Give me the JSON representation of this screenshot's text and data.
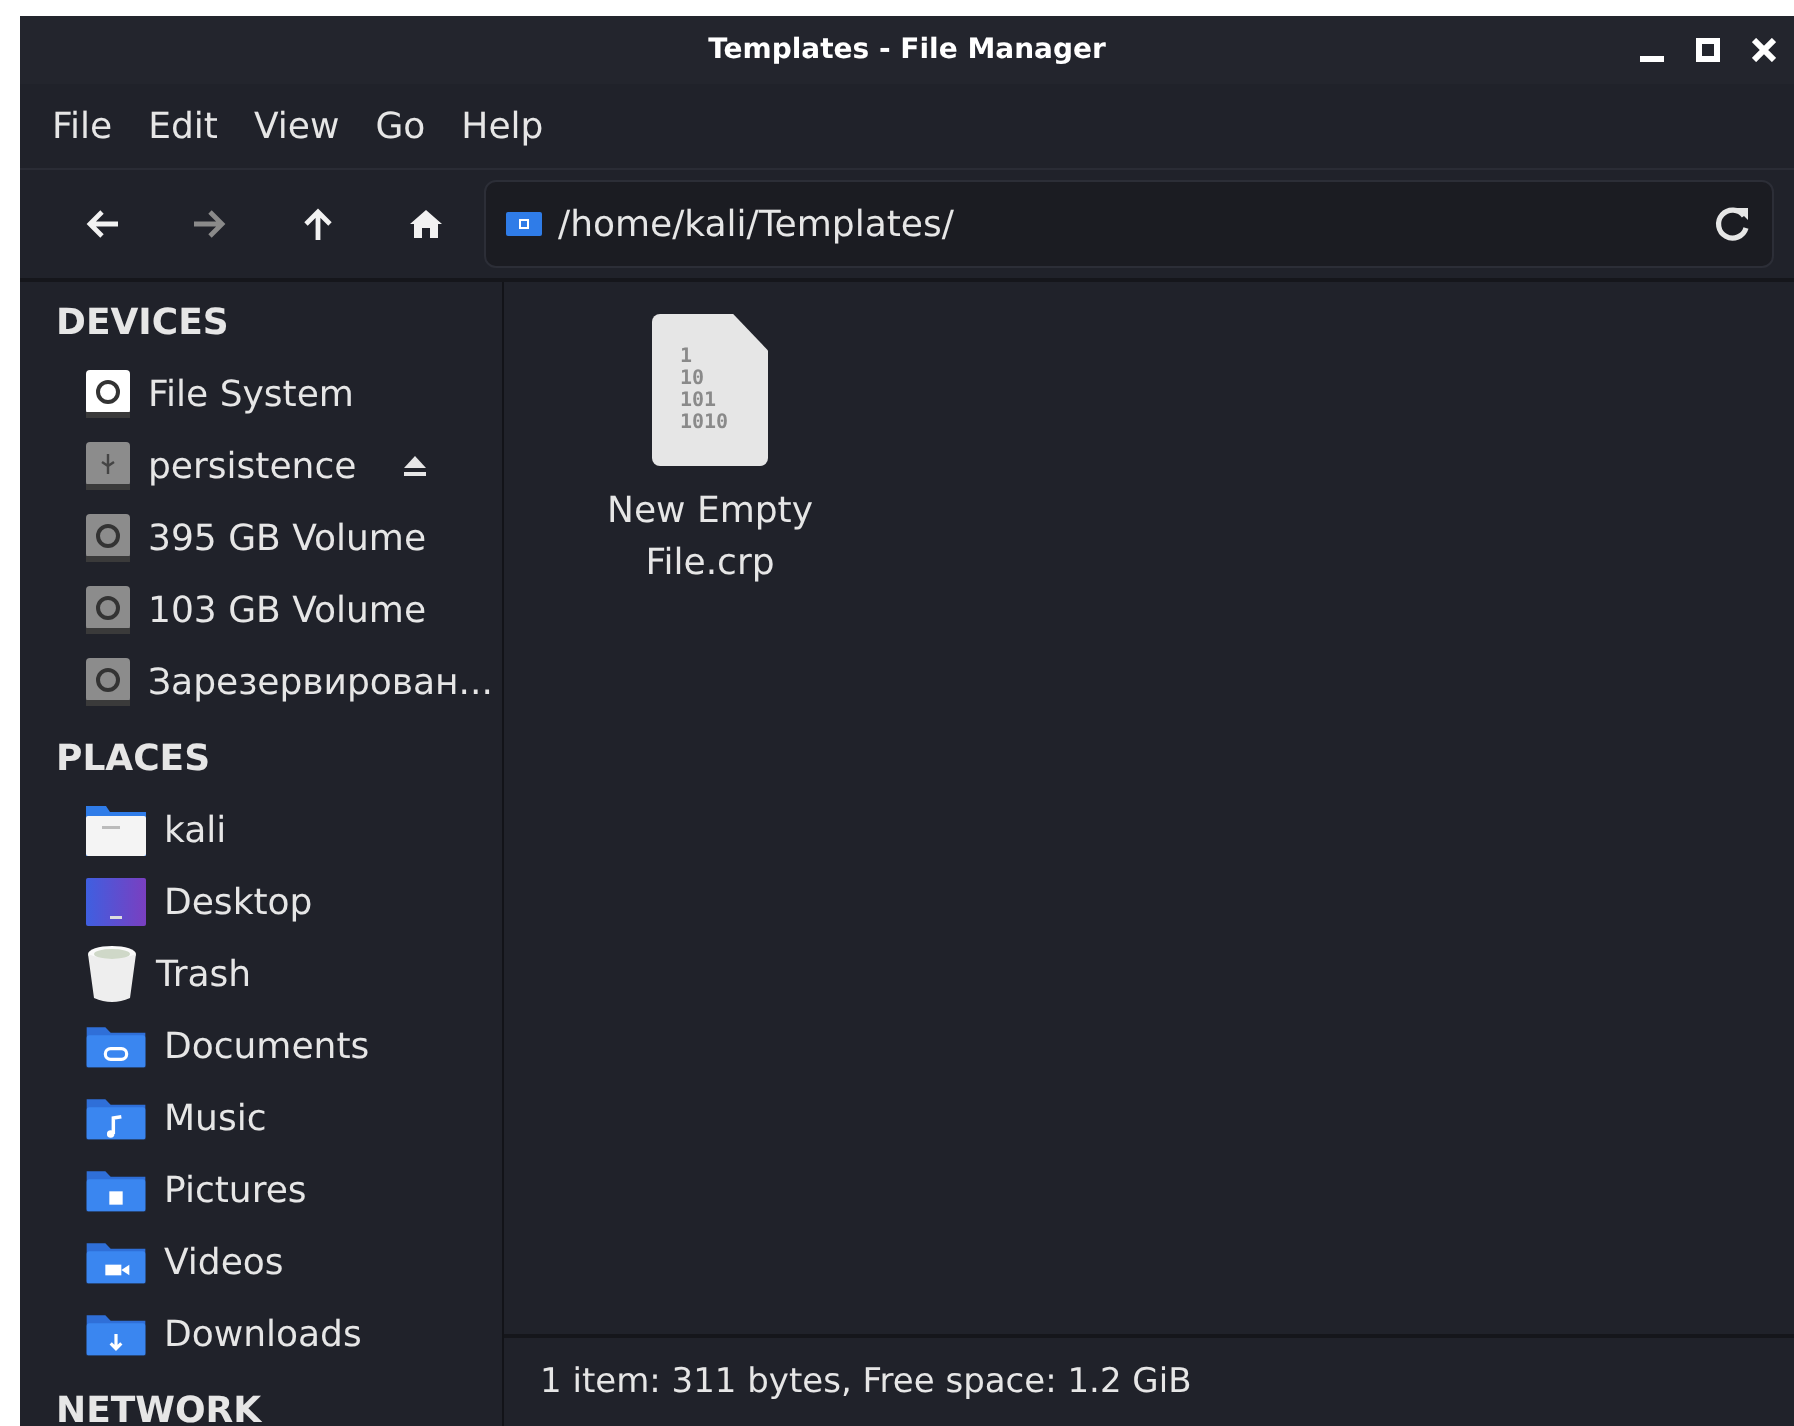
{
  "window": {
    "title": "Templates - File Manager"
  },
  "menu": [
    "File",
    "Edit",
    "View",
    "Go",
    "Help"
  ],
  "toolbar": {
    "back_disabled": false,
    "forward_disabled": true,
    "path": "/home/kali/Templates/"
  },
  "sidebar": [
    {
      "heading": "DEVICES",
      "items": [
        {
          "label": "File System",
          "kind": "root",
          "ejectable": false
        },
        {
          "label": "persistence",
          "kind": "usb",
          "ejectable": true
        },
        {
          "label": "395 GB Volume",
          "kind": "drive",
          "ejectable": false
        },
        {
          "label": "103 GB Volume",
          "kind": "drive",
          "ejectable": false
        },
        {
          "label": "Зарезервирован...",
          "kind": "drive",
          "ejectable": false
        }
      ]
    },
    {
      "heading": "PLACES",
      "items": [
        {
          "label": "kali",
          "kind": "home",
          "ejectable": false
        },
        {
          "label": "Desktop",
          "kind": "desktop",
          "ejectable": false
        },
        {
          "label": "Trash",
          "kind": "trash",
          "ejectable": false
        },
        {
          "label": "Documents",
          "kind": "documents",
          "ejectable": false
        },
        {
          "label": "Music",
          "kind": "music",
          "ejectable": false
        },
        {
          "label": "Pictures",
          "kind": "pictures",
          "ejectable": false
        },
        {
          "label": "Videos",
          "kind": "videos",
          "ejectable": false
        },
        {
          "label": "Downloads",
          "kind": "downloads",
          "ejectable": false
        }
      ]
    },
    {
      "heading": "NETWORK"
    }
  ],
  "files": [
    {
      "name": "New Empty File.crp",
      "icon_lines": [
        "1",
        "10",
        "101",
        "1010"
      ],
      "selected": false
    }
  ],
  "status_bar": "1 item: 311 bytes, Free space: 1.2 GiB"
}
